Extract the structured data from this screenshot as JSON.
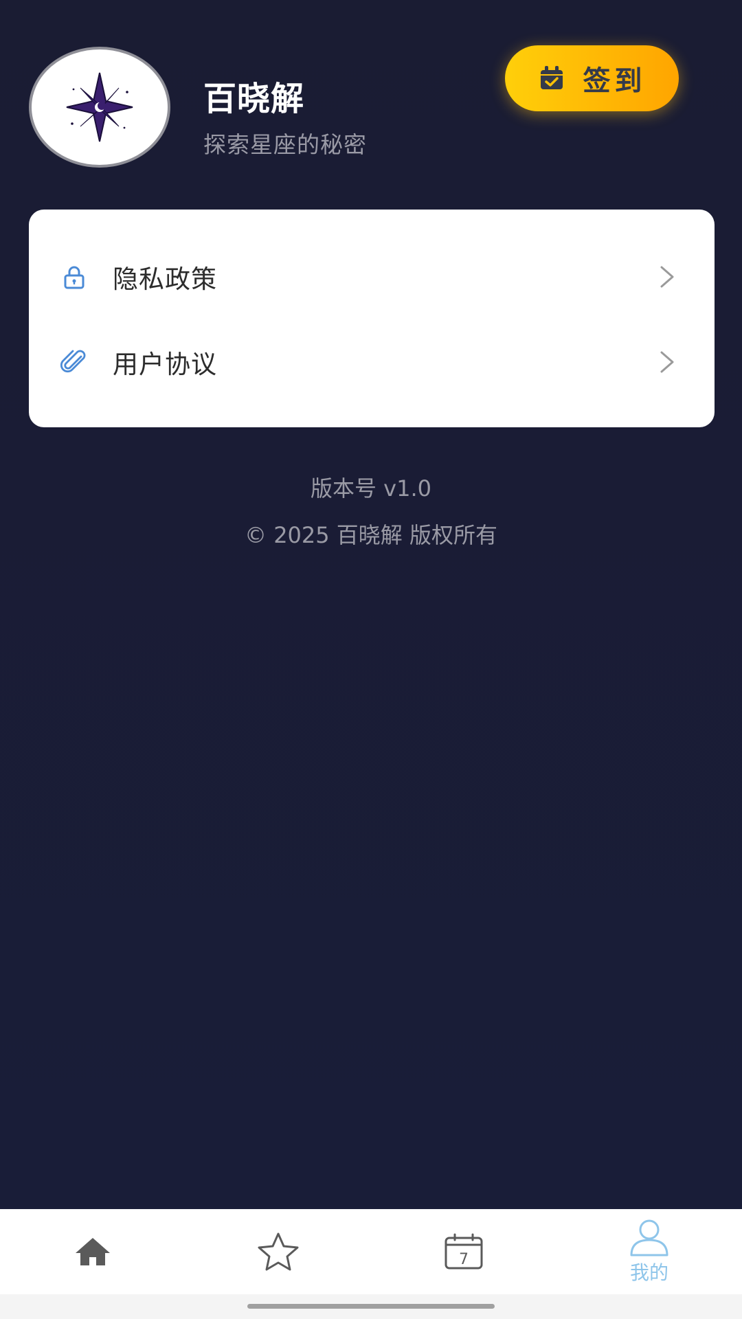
{
  "profile": {
    "app_name": "百晓解",
    "tagline": "探索星座的秘密",
    "avatar_icon": "star-compass-logo"
  },
  "checkin": {
    "label": "签到",
    "icon": "calendar-check-icon",
    "colors": [
      "#ffcf0a",
      "#ffa500"
    ]
  },
  "menu": {
    "items": [
      {
        "label": "隐私政策",
        "icon": "lock-icon"
      },
      {
        "label": "用户协议",
        "icon": "paperclip-icon"
      }
    ]
  },
  "footer": {
    "version": "版本号 v1.0",
    "copyright": "© 2025 百晓解 版权所有"
  },
  "nav": {
    "items": [
      {
        "icon": "home-icon",
        "label": "",
        "active": false
      },
      {
        "icon": "star-icon",
        "label": "",
        "active": false
      },
      {
        "icon": "calendar-icon",
        "label": "",
        "calendar_day": "7",
        "active": false
      },
      {
        "icon": "user-icon",
        "label": "我的",
        "active": true
      }
    ],
    "active_color": "#8ec5ea",
    "inactive_color": "#5a5a5a"
  },
  "colors": {
    "background": "#191d36",
    "card": "#ffffff",
    "accent_blue": "#4a8ad6"
  }
}
